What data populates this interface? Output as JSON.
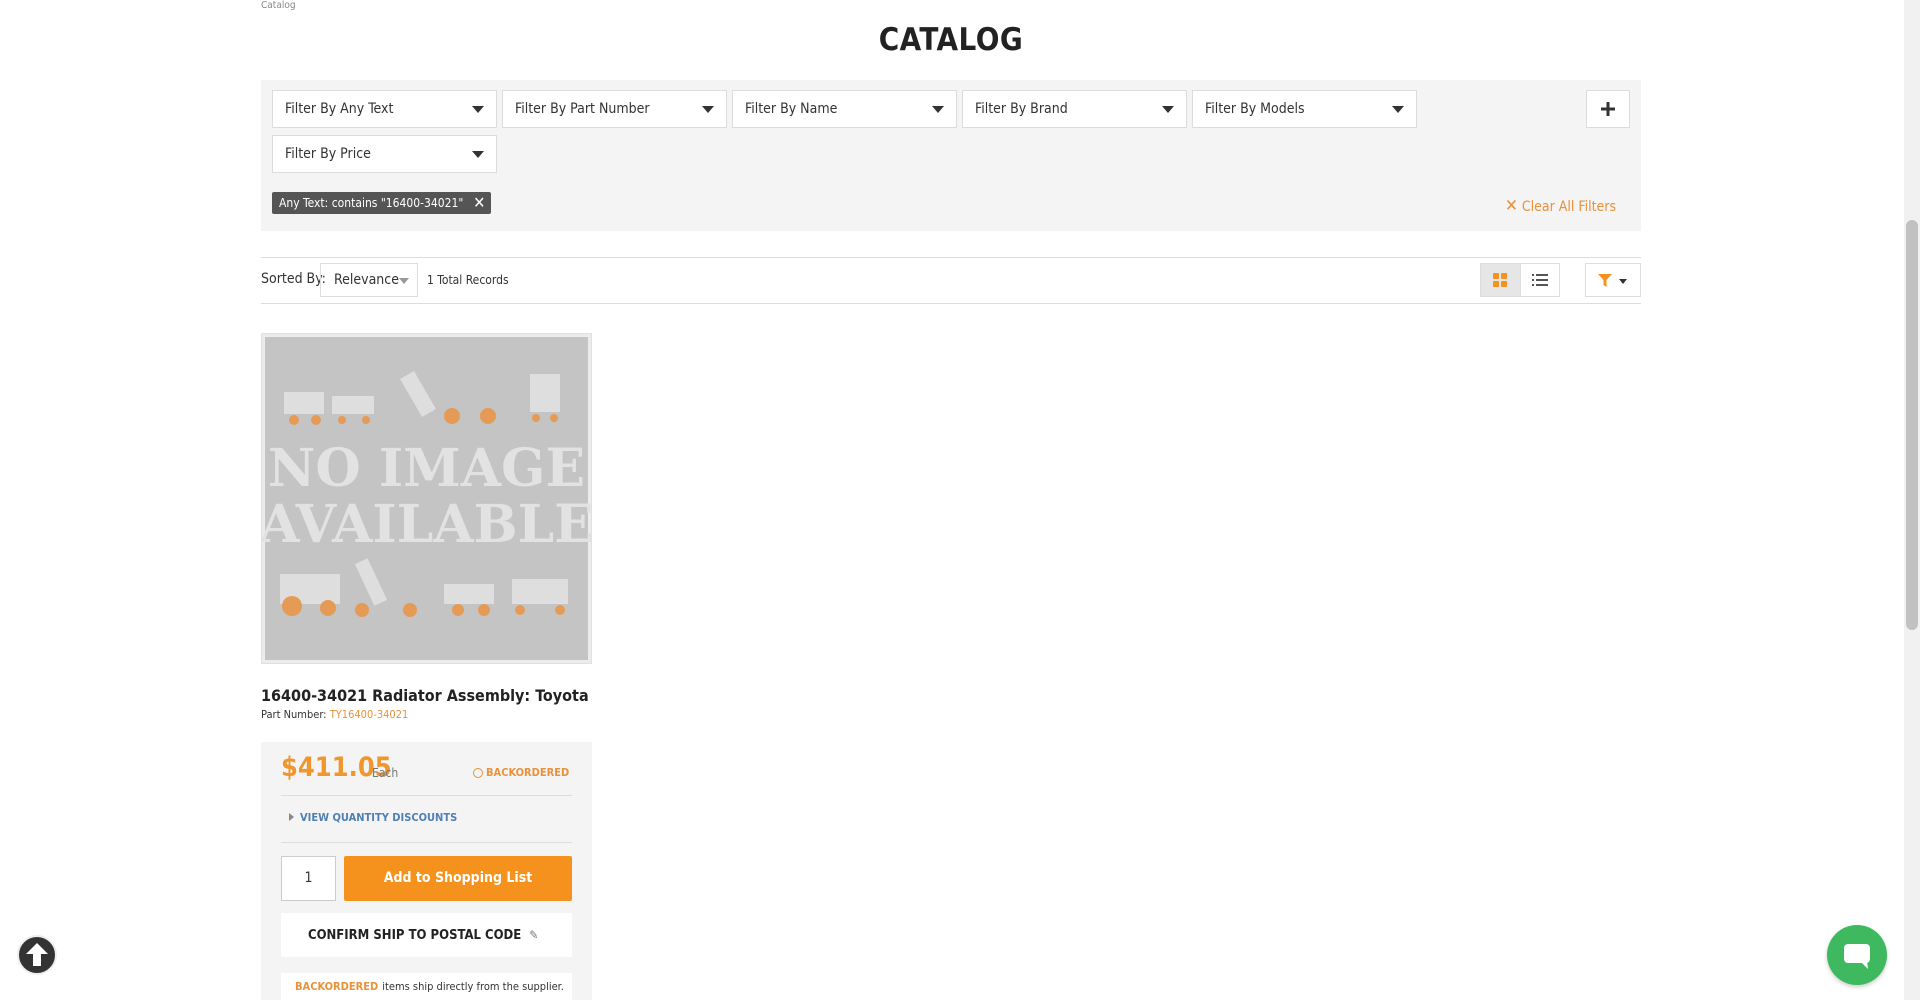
{
  "breadcrumb": "Catalog",
  "page": {
    "title": "CATALOG"
  },
  "filters": {
    "any_text": "Filter By Any Text",
    "part_number": "Filter By Part Number",
    "name": "Filter By Name",
    "brand": "Filter By Brand",
    "models": "Filter By Models",
    "price": "Filter By Price",
    "add_icon": "plus-icon",
    "active_chip": "Any Text: contains \"16400-34021\"",
    "clear_all": "Clear All Filters"
  },
  "sort": {
    "label": "Sorted By:",
    "value": "Relevance",
    "total": "1 Total Records"
  },
  "product": {
    "image_text_line1": "NO IMAGE",
    "image_text_line2": "AVAILABLE",
    "title": "16400-34021 Radiator Assembly: Toyota",
    "part_label": "Part Number:",
    "part_number": "TY16400-34021",
    "price": "$411.05",
    "unit": "Each",
    "stock_status": "BACKORDERED",
    "quantity_discounts": "VIEW QUANTITY DISCOUNTS",
    "quantity": "1",
    "add_button": "Add to Shopping List",
    "confirm_ship": "CONFIRM SHIP TO POSTAL CODE",
    "ship_note_badge": "BACKORDERED",
    "ship_note_text": "items ship directly from the supplier."
  },
  "colors": {
    "accent": "#f5921e",
    "link": "#4f7fb3",
    "chat": "#3fb960",
    "chip": "#555555"
  }
}
